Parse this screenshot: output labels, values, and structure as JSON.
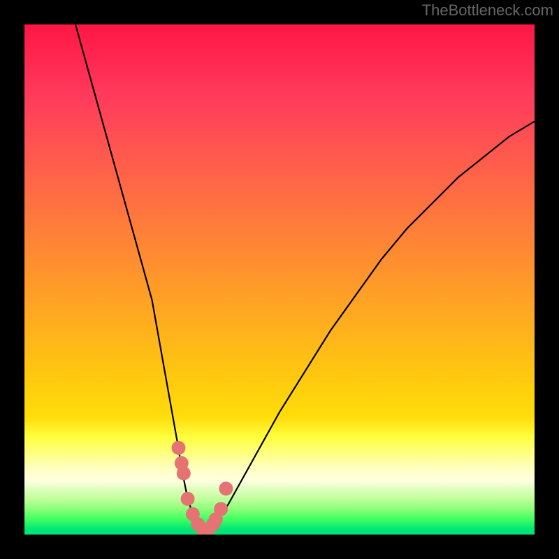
{
  "watermark": "TheBottleneck.com",
  "chart_data": {
    "type": "line",
    "title": "",
    "xlabel": "",
    "ylabel": "",
    "xlim": [
      0,
      100
    ],
    "ylim": [
      0,
      100
    ],
    "grid": false,
    "legend": false,
    "annotations": [],
    "series": [
      {
        "name": "bottleneck-curve",
        "color": "#000000",
        "x": [
          10,
          15,
          20,
          25,
          30,
          31,
          32,
          33,
          34,
          35,
          36,
          37,
          38,
          40,
          45,
          50,
          55,
          60,
          65,
          70,
          75,
          80,
          85,
          90,
          95,
          100
        ],
        "y": [
          100,
          82,
          64,
          46,
          18,
          12,
          7,
          4,
          2,
          1,
          1,
          2,
          3,
          6,
          15,
          24,
          32,
          40,
          47,
          54,
          60,
          65,
          70,
          74,
          78,
          81
        ]
      },
      {
        "name": "highlight-points",
        "color": "#e57373",
        "type": "scatter",
        "x": [
          30.2,
          30.8,
          31.2,
          32.0,
          33.0,
          34.0,
          35.0,
          36.0,
          37.0,
          37.5,
          38.5,
          39.5
        ],
        "y": [
          17,
          14,
          12,
          7,
          4,
          2,
          1,
          1,
          2,
          3,
          5,
          9
        ]
      }
    ],
    "gradient_bands": {
      "description": "vertical gradient from red (top, high bottleneck) through orange/yellow to green (bottom, good)",
      "stops": [
        {
          "pos": 0,
          "color": "#ff1744"
        },
        {
          "pos": 50,
          "color": "#ff952c"
        },
        {
          "pos": 80,
          "color": "#ffff40"
        },
        {
          "pos": 100,
          "color": "#00e676"
        }
      ]
    }
  }
}
